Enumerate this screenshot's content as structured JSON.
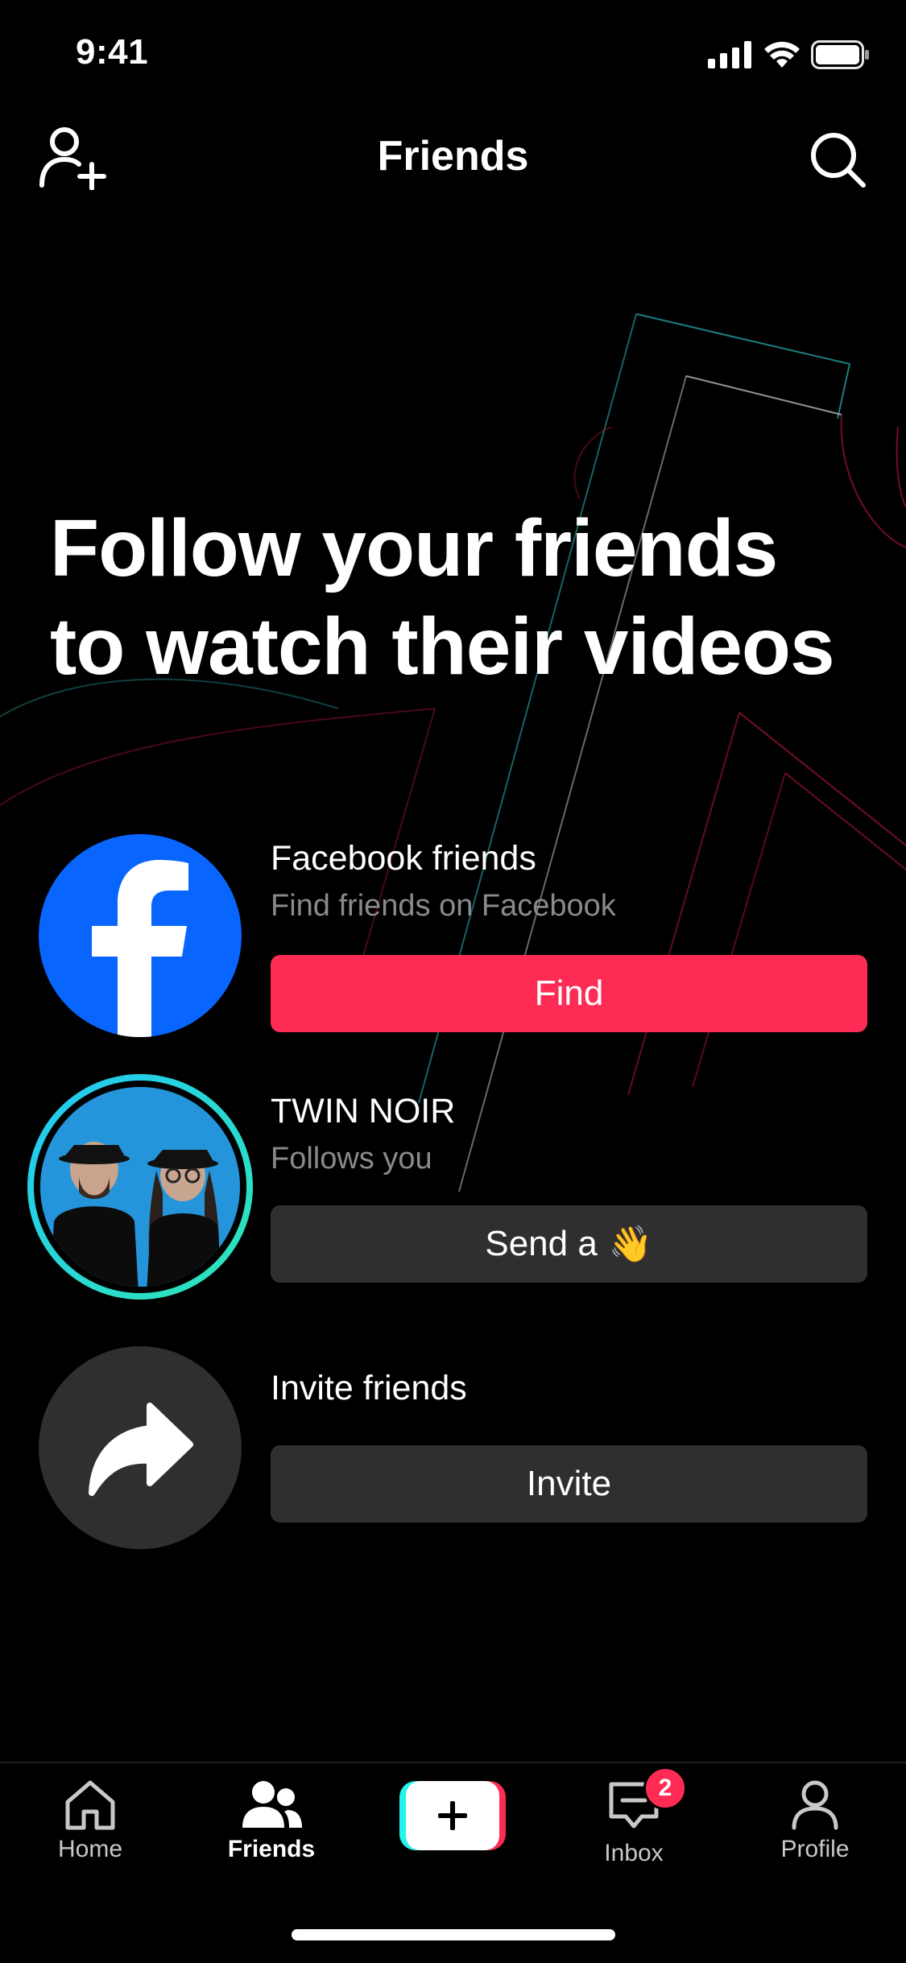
{
  "status_bar": {
    "time": "9:41",
    "icons": [
      "signal-icon",
      "wifi-icon",
      "battery-icon"
    ]
  },
  "header": {
    "title": "Friends",
    "left_icon": "add-user-icon",
    "right_icon": "search-icon"
  },
  "headline": "Follow your friends to watch their videos",
  "rows": {
    "facebook": {
      "title": "Facebook friends",
      "subtitle": "Find friends on Facebook",
      "button": "Find",
      "icon": "facebook-logo-icon"
    },
    "suggested": {
      "title": "TWIN NOIR",
      "subtitle": "Follows you",
      "button": "Send a",
      "button_emoji": "👋"
    },
    "invite": {
      "title": "Invite friends",
      "button": "Invite",
      "icon": "share-arrow-icon"
    }
  },
  "tabbar": {
    "items": [
      {
        "label": "Home",
        "icon": "home-icon",
        "active": false
      },
      {
        "label": "Friends",
        "icon": "friends-icon",
        "active": true
      },
      {
        "label": "",
        "icon": "create-plus-icon",
        "active": false
      },
      {
        "label": "Inbox",
        "icon": "inbox-icon",
        "active": false,
        "badge": "2"
      },
      {
        "label": "Profile",
        "icon": "profile-icon",
        "active": false
      }
    ]
  },
  "colors": {
    "accent_red": "#fe2c55",
    "button_gray": "#2f2f2f",
    "facebook_blue": "#0866ff",
    "ring_start": "#22c8f5",
    "ring_end": "#2ee6b5"
  }
}
